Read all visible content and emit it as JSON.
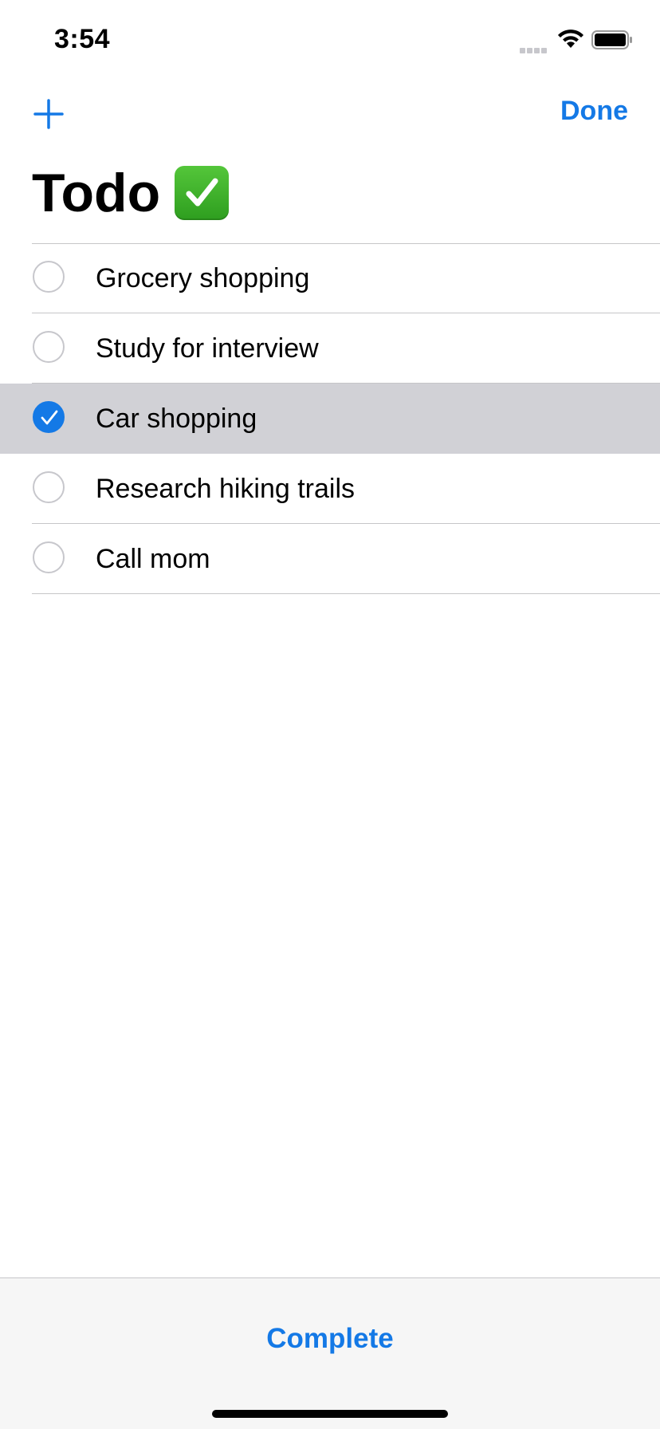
{
  "status_bar": {
    "time": "3:54",
    "icons": [
      "cellular-signal-icon",
      "wifi-icon",
      "battery-icon"
    ]
  },
  "nav_bar": {
    "add_icon": "plus-icon",
    "done_label": "Done"
  },
  "title": {
    "text": "Todo",
    "emoji_icon": "check-mark-button-icon"
  },
  "todos": [
    {
      "label": "Grocery shopping",
      "selected": false
    },
    {
      "label": "Study for interview",
      "selected": false
    },
    {
      "label": "Car shopping",
      "selected": true
    },
    {
      "label": "Research hiking trails",
      "selected": false
    },
    {
      "label": "Call mom",
      "selected": false
    }
  ],
  "toolbar": {
    "complete_label": "Complete"
  },
  "colors": {
    "accent": "#1479e6",
    "selected_row": "#d1d1d6",
    "separator": "#c6c6c8",
    "toolbar_bg": "#f6f6f6"
  }
}
